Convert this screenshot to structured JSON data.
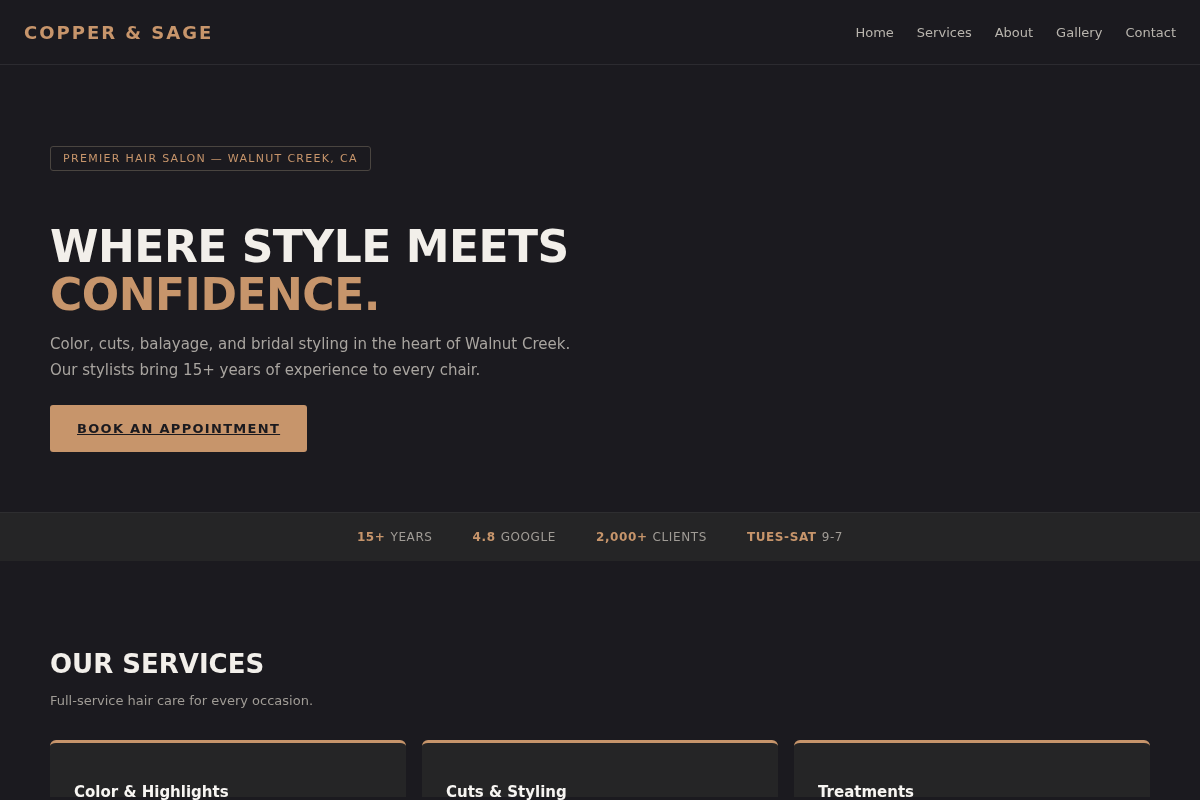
{
  "brand": "COPPER & SAGE",
  "nav": [
    {
      "label": "Home"
    },
    {
      "label": "Services"
    },
    {
      "label": "About"
    },
    {
      "label": "Gallery"
    },
    {
      "label": "Contact"
    }
  ],
  "hero": {
    "eyebrow": "PREMIER HAIR SALON — WALNUT CREEK, CA",
    "title_line_1": "WHERE STYLE MEETS",
    "title_line_2": "CONFIDENCE.",
    "lead_lines": [
      "Color, cuts, balayage, and bridal styling in the heart of Walnut Creek.",
      "Our stylists bring 15+ years of experience to every chair."
    ],
    "cta": "BOOK AN APPOINTMENT"
  },
  "stats": [
    {
      "value": "15+",
      "label": "YEARS"
    },
    {
      "value": "4.8",
      "label": "GOOGLE"
    },
    {
      "value": "2,000+",
      "label": "CLIENTS"
    },
    {
      "value": "TUES-SAT",
      "label": "9-7"
    }
  ],
  "services": {
    "title": "OUR SERVICES",
    "subtitle": "Full-service hair care for every occasion.",
    "cards": [
      {
        "title": "Color & Highlights"
      },
      {
        "title": "Cuts & Styling"
      },
      {
        "title": "Treatments"
      }
    ]
  }
}
